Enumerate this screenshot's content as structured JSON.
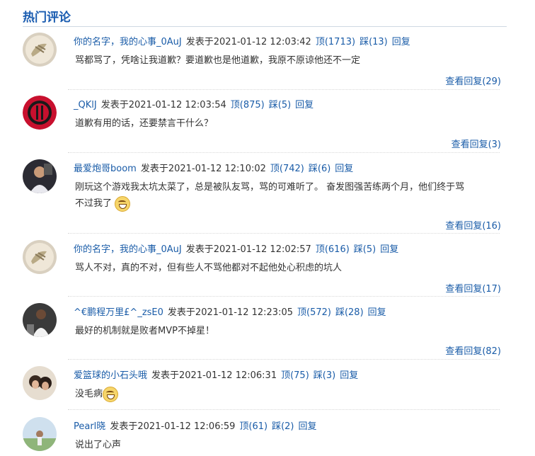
{
  "section": {
    "title": "热门评论"
  },
  "comments": [
    {
      "user": "你的名字，我的心事_0AuJ",
      "time": "发表于2021-01-12 12:03:42",
      "up": "顶(1713)",
      "down": "踩(13)",
      "reply": "回复",
      "text": "骂都骂了，凭啥让我道歉？要道歉也是他道歉，我原不原谅他还不一定",
      "more": "查看回复(29)",
      "avatar": "avatar-1"
    },
    {
      "user": "_QKlJ",
      "time": "发表于2021-01-12 12:03:54",
      "up": "顶(875)",
      "down": "踩(5)",
      "reply": "回复",
      "text": "道歉有用的话，还要禁言干什么？",
      "more": "查看回复(3)",
      "avatar": "avatar-2"
    },
    {
      "user": "最爱炮哥boom",
      "time": "发表于2021-01-12 12:10:02",
      "up": "顶(742)",
      "down": "踩(6)",
      "reply": "回复",
      "text_line1": "刚玩这个游戏我太坑太菜了，总是被队友骂，骂的可难听了。 奋发图强苦练两个月，他们终于骂",
      "text_line2": "不过我了",
      "emoji": "grin-emoji",
      "more": "查看回复(16)",
      "avatar": "avatar-3"
    },
    {
      "user": "你的名字，我的心事_0AuJ",
      "time": "发表于2021-01-12 12:02:57",
      "up": "顶(616)",
      "down": "踩(5)",
      "reply": "回复",
      "text": "骂人不对，真的不对，但有些人不骂他都对不起他处心积虑的坑人",
      "more": "查看回复(17)",
      "avatar": "avatar-4"
    },
    {
      "user": "^€鹏程万里£^_zsE0",
      "time": "发表于2021-01-12 12:23:05",
      "up": "顶(572)",
      "down": "踩(28)",
      "reply": "回复",
      "text": "最好的机制就是败者MVP不掉星！",
      "more": "查看回复(82)",
      "avatar": "avatar-5"
    },
    {
      "user": "爱篮球的小石头哦",
      "time": "发表于2021-01-12 12:06:31",
      "up": "顶(75)",
      "down": "踩(3)",
      "reply": "回复",
      "text": "没毛病",
      "emoji": "grin-emoji",
      "more": "",
      "avatar": "avatar-6"
    },
    {
      "user": "Pearl晓",
      "time": "发表于2021-01-12 12:06:59",
      "up": "顶(61)",
      "down": "踩(2)",
      "reply": "回复",
      "text": "说出了心声",
      "more": "",
      "avatar": "avatar-7"
    }
  ],
  "colors": {
    "link": "#1a5ca8",
    "title": "#1a5cb0",
    "divider": "#d8d8d8"
  }
}
